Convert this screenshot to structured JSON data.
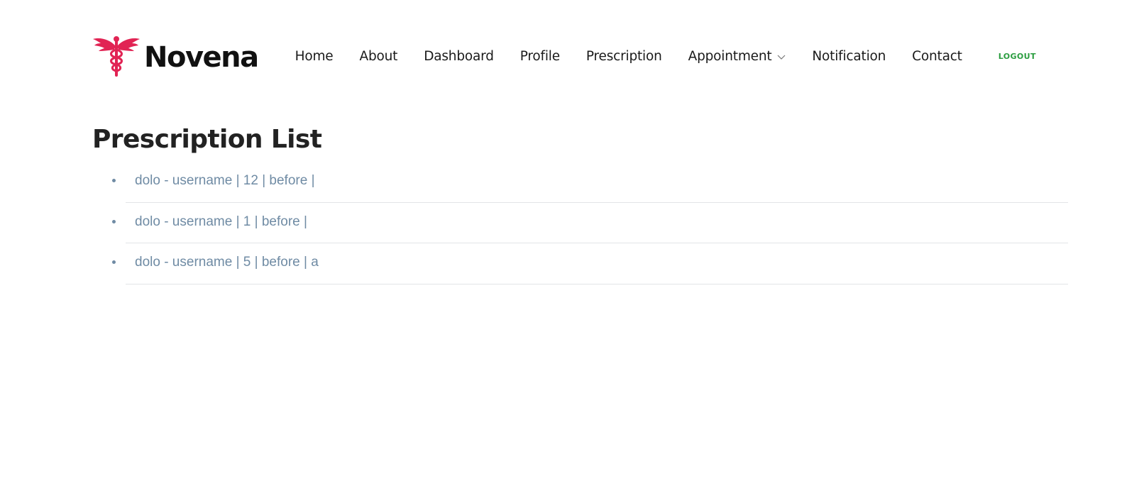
{
  "brand": {
    "name": "Novena",
    "logo_icon": "caduceus-icon",
    "logo_color": "#e12454"
  },
  "nav": {
    "items": [
      {
        "label": "Home"
      },
      {
        "label": "About"
      },
      {
        "label": "Dashboard"
      },
      {
        "label": "Profile"
      },
      {
        "label": "Prescription"
      },
      {
        "label": "Appointment",
        "has_dropdown": true
      },
      {
        "label": "Notification"
      },
      {
        "label": "Contact"
      }
    ],
    "logout_label": "LOGOUT"
  },
  "main": {
    "title": "Prescription List",
    "prescriptions": [
      {
        "text": "dolo - username | 12 | before |"
      },
      {
        "text": "dolo - username | 1 | before |"
      },
      {
        "text": "dolo - username | 5 | before | a"
      }
    ]
  },
  "colors": {
    "accent_red": "#e12454",
    "nav_text": "#1a1a1a",
    "logout_green": "#2a9d3f",
    "list_text": "#6f8ba4",
    "divider": "#e2e4e7"
  }
}
